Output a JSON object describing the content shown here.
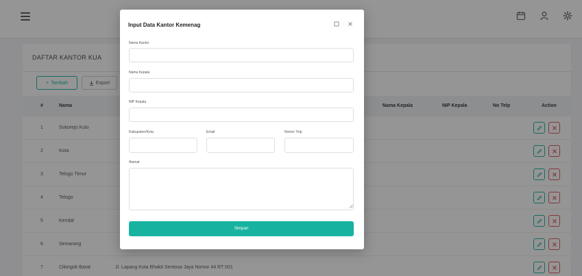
{
  "page": {
    "section_title": "DAFTAR KANTOR KUA",
    "toolbar": {
      "add_label": "Tambah",
      "export_label": "Export"
    },
    "table": {
      "headers": {
        "no": "#",
        "name": "Nama",
        "head_name": "Nama Kepala",
        "head_nip": "NIP Kepala",
        "phone": "No Telp",
        "action": "Action"
      },
      "rows": [
        {
          "no": "1",
          "name": "Sukorejo Kulo",
          "address": ""
        },
        {
          "no": "2",
          "name": "Kota",
          "address": ""
        },
        {
          "no": "3",
          "name": "Telogo Timur",
          "address": ""
        },
        {
          "no": "4",
          "name": "Telogo",
          "address": ""
        },
        {
          "no": "5",
          "name": "Kendal",
          "address": ""
        },
        {
          "no": "6",
          "name": "Semarang",
          "address": ""
        },
        {
          "no": "7",
          "name": "Cilongok Barat",
          "address": "Jl. Lapang Kota Bhakti Sentosa Jaya Nomor 44 RT 001"
        }
      ]
    }
  },
  "modal": {
    "title": "Input Data Kantor Kemenag",
    "fields": {
      "nama_kantor": {
        "label": "Nama Kantor",
        "value": "",
        "placeholder": ""
      },
      "nama_kepala": {
        "label": "Nama Kepala",
        "value": "",
        "placeholder": ""
      },
      "nip_kepala": {
        "label": "NIP Kepala",
        "value": "",
        "placeholder": ""
      },
      "kabupaten": {
        "label": "Kabupaten/Kota",
        "value": "",
        "placeholder": ""
      },
      "email": {
        "label": "Email",
        "value": "",
        "placeholder": ""
      },
      "nomor_telp": {
        "label": "Nomor Telp",
        "value": "",
        "placeholder": ""
      },
      "alamat": {
        "label": "Alamat",
        "value": "",
        "placeholder": ""
      }
    },
    "submit_label": "Simpan"
  },
  "icons": {
    "hamburger": "menu-icon",
    "top_right": [
      "calendar-icon",
      "user-icon",
      "gear-icon"
    ],
    "modal": [
      "maximize-icon",
      "close-icon"
    ],
    "row_actions": [
      "edit-icon",
      "delete-icon"
    ]
  },
  "colors": {
    "accent": "#17b3a0",
    "danger": "#e0505c",
    "overlay": "rgba(20,20,20,0.45)"
  }
}
